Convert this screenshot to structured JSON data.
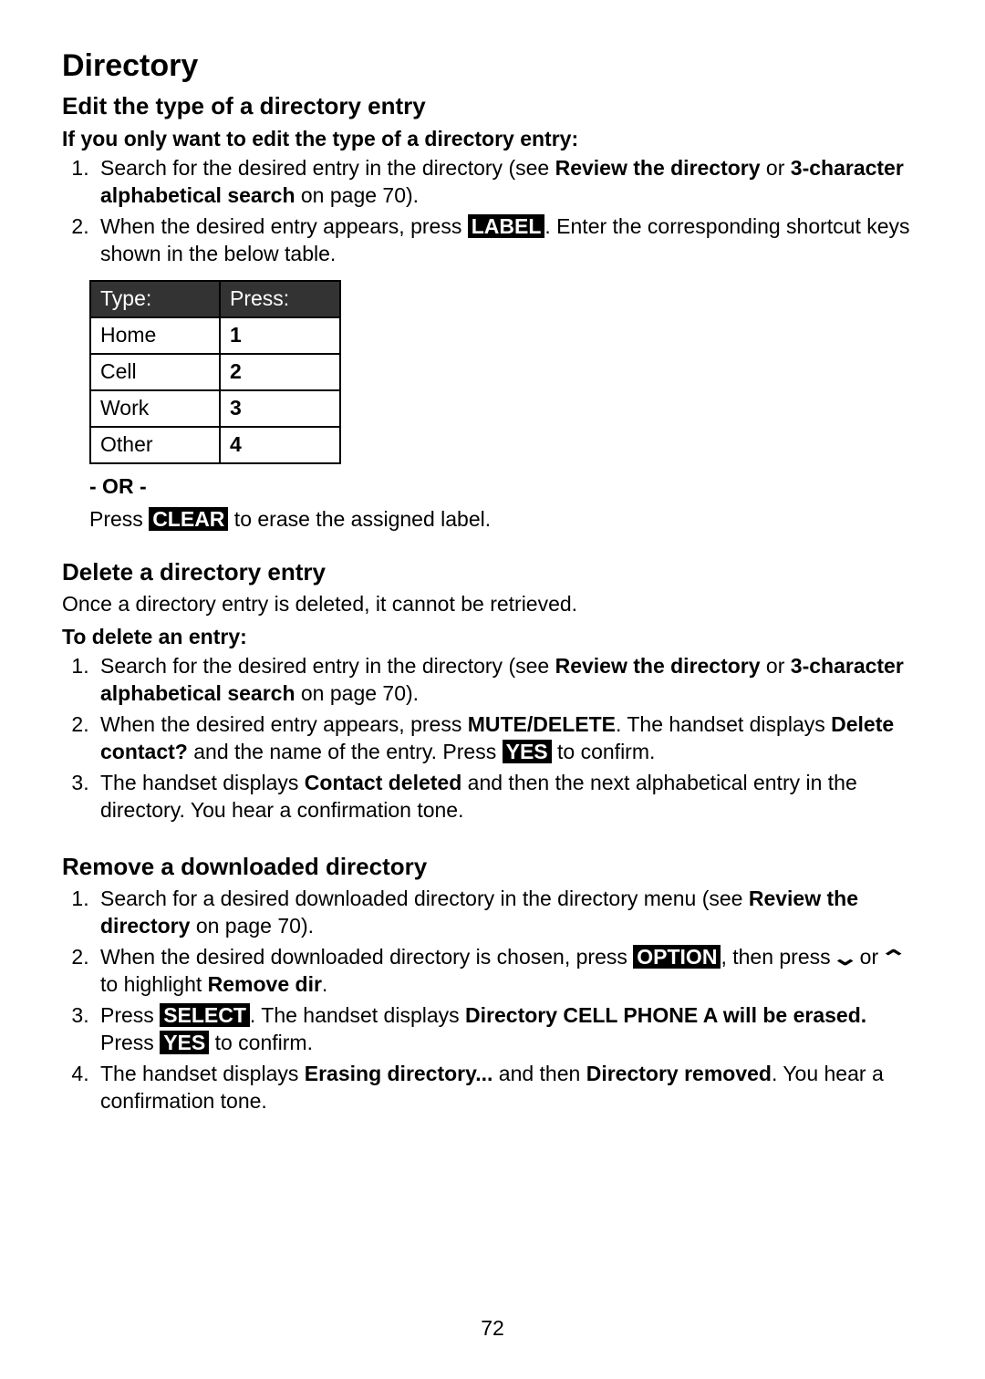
{
  "page_title": "Directory",
  "page_number": "72",
  "edit_section": {
    "heading": "Edit the type of a directory entry",
    "subhead": "If you only want to edit the type of a directory entry:",
    "step1_a": "Search for the desired entry in the directory (see ",
    "step1_b": "Review the directory",
    "step1_c": " or ",
    "step1_d": "3-character alphabetical search",
    "step1_e": " on page 70).",
    "step2_a": "When the desired entry appears, press ",
    "step2_label": "LABEL",
    "step2_b": ". Enter the corresponding shortcut keys shown in the below table.",
    "or_text": "- OR -",
    "press_text": "Press ",
    "clear_btn": "CLEAR",
    "erase_text": " to erase the assigned label."
  },
  "table": {
    "h1": "Type:",
    "h2": "Press:",
    "rows": [
      {
        "type": "Home",
        "press": "1"
      },
      {
        "type": "Cell",
        "press": "2"
      },
      {
        "type": "Work",
        "press": "3"
      },
      {
        "type": "Other",
        "press": "4"
      }
    ]
  },
  "delete_section": {
    "heading": "Delete a directory entry",
    "intro": "Once a directory entry is deleted, it cannot be retrieved.",
    "subhead": "To delete an entry:",
    "step1_a": "Search for the desired entry in the directory (see ",
    "step1_b": "Review the directory",
    "step1_c": " or ",
    "step1_d": "3-character alphabetical search",
    "step1_e": " on page 70).",
    "step2_a": "When the desired entry appears, press ",
    "step2_mute": "MUTE",
    "step2_delete": "/DELETE",
    "step2_b": ". The handset displays ",
    "step2_c": "Delete contact?",
    "step2_d": " and the name of the entry. Press ",
    "step2_yes": "YES",
    "step2_e": " to confirm.",
    "step3_a": "The handset displays ",
    "step3_b": "Contact deleted",
    "step3_c": " and then the next alphabetical entry in the directory. You hear a confirmation tone."
  },
  "remove_section": {
    "heading": "Remove a downloaded directory",
    "step1_a": "Search for a desired downloaded directory in the directory menu (see ",
    "step1_b": "Review the directory",
    "step1_c": " on page 70).",
    "step2_a": "When the desired downloaded directory is chosen, press ",
    "step2_option": "OPTION",
    "step2_b": ", then press ",
    "step2_c": " or ",
    "step2_d": " to highlight ",
    "step2_e": "Remove dir",
    "step2_f": ".",
    "step3_a": "Press ",
    "step3_select": "SELECT",
    "step3_b": ". The handset displays ",
    "step3_c": "Directory CELL PHONE A will be erased.",
    "step3_d": " Press ",
    "step3_yes": "YES",
    "step3_e": " to confirm.",
    "step4_a": "The handset displays ",
    "step4_b": "Erasing directory...",
    "step4_c": " and then ",
    "step4_d": "Directory removed",
    "step4_e": ". You hear a confirmation tone."
  }
}
